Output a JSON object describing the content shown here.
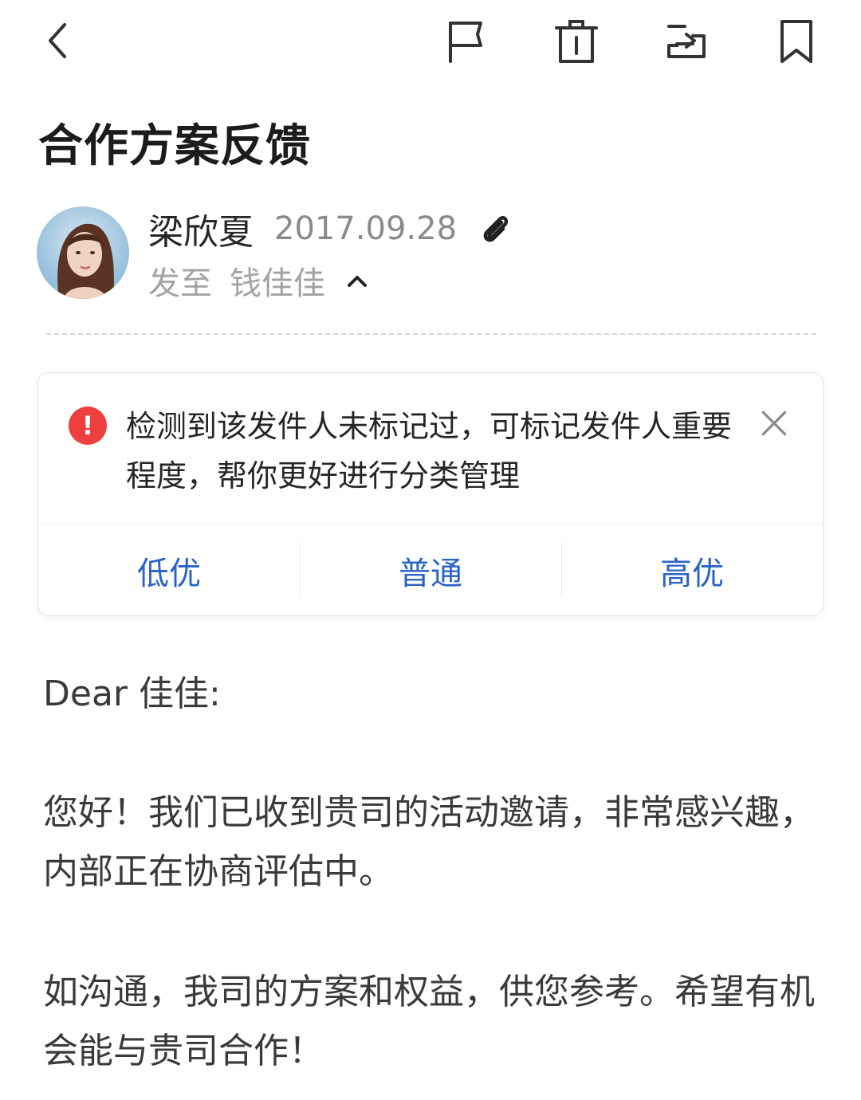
{
  "toolbar": {
    "icons": [
      "back-icon",
      "flag-icon",
      "trash-icon",
      "move-icon",
      "bookmark-icon"
    ]
  },
  "mail": {
    "subject": "合作方案反馈",
    "sender_name": "梁欣夏",
    "date": "2017.09.28",
    "recipient_label": "发至",
    "recipient_name": "钱佳佳"
  },
  "notice": {
    "message": "检测到该发件人未标记过，可标记发件人重要程度，帮你更好进行分类管理",
    "options": [
      "低优",
      "普通",
      "高优"
    ],
    "accent_color": "#2a63c7",
    "alert_color": "#ee3f3f"
  },
  "body": {
    "greeting": "Dear 佳佳:",
    "paragraph1": "您好！我们已收到贵司的活动邀请，非常感兴趣，内部正在协商评估中。",
    "paragraph2": "如沟通，我司的方案和权益，供您参考。希望有机会能与贵司合作！"
  }
}
